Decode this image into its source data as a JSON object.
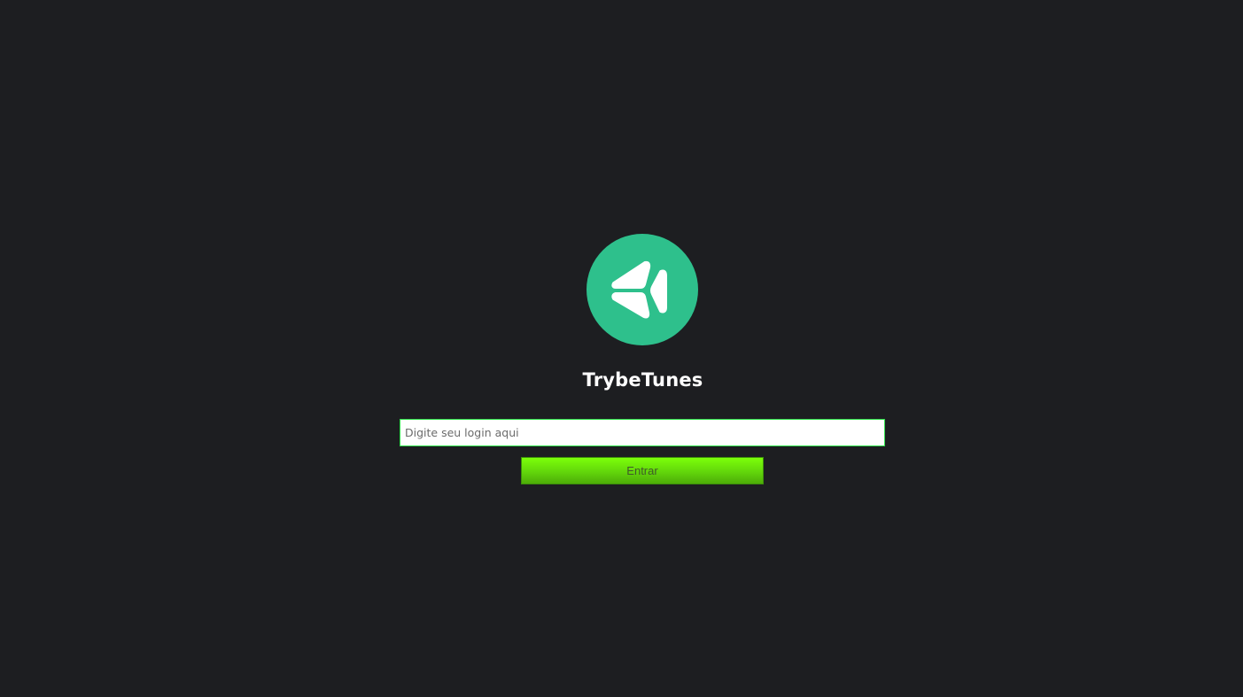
{
  "app": {
    "title": "TrybeTunes",
    "logo_icon": "trybe-logo-icon",
    "logo_color": "#2ec08c"
  },
  "login": {
    "input_placeholder": "Digite seu login aqui",
    "input_value": "",
    "submit_label": "Entrar"
  },
  "colors": {
    "background": "#1d1e21",
    "input_border": "#2ee04a",
    "button_top": "#7cff0a",
    "button_bottom": "#4dac08"
  }
}
